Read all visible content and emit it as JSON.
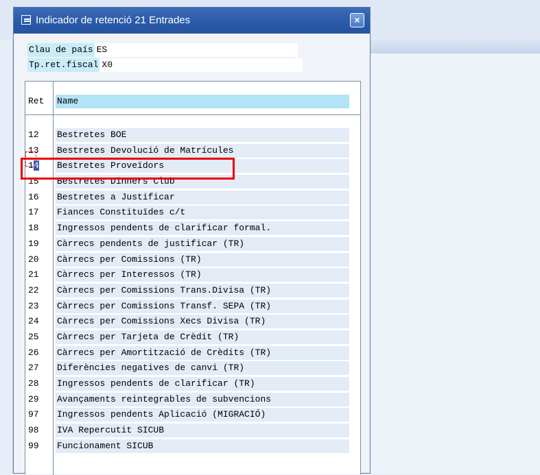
{
  "popup": {
    "title": "Indicador de retenció 21 Entrades",
    "close_label": "×"
  },
  "criteria": [
    {
      "label": "Clau de país",
      "value": "ES"
    },
    {
      "label": "Tp.ret.fiscal",
      "value": "X0"
    }
  ],
  "table": {
    "columns": [
      "Ret",
      "Name"
    ],
    "selected_code": "14",
    "rows": [
      {
        "code": "12",
        "name": "Bestretes BOE"
      },
      {
        "code": "13",
        "name": "Bestretes Devolució de Matrícules"
      },
      {
        "code": "14",
        "name": "Bestretes Proveïdors"
      },
      {
        "code": "15",
        "name": "Bestretes Dinners Club"
      },
      {
        "code": "16",
        "name": "Bestretes a Justificar"
      },
      {
        "code": "17",
        "name": "Fiances Constituïdes c/t"
      },
      {
        "code": "18",
        "name": "Ingressos pendents de clarificar formal."
      },
      {
        "code": "19",
        "name": "Càrrecs pendents de justificar (TR)"
      },
      {
        "code": "20",
        "name": "Càrrecs per Comissions (TR)"
      },
      {
        "code": "21",
        "name": "Càrrecs per Interessos (TR)"
      },
      {
        "code": "22",
        "name": "Càrrecs per Comissions Trans.Divisa (TR)"
      },
      {
        "code": "23",
        "name": "Càrrecs per Comissions Transf. SEPA (TR)"
      },
      {
        "code": "24",
        "name": "Càrrecs per Comissions Xecs Divisa (TR)"
      },
      {
        "code": "25",
        "name": "Càrrecs per Tarjeta de Crèdit (TR)"
      },
      {
        "code": "26",
        "name": "Càrrecs per Amortització de Crèdits (TR)"
      },
      {
        "code": "27",
        "name": "Diferències negatives de canvi (TR)"
      },
      {
        "code": "28",
        "name": "Ingressos pendents de clarificar (TR)"
      },
      {
        "code": "29",
        "name": "Avançaments reintegrables de subvencions"
      },
      {
        "code": "97",
        "name": "Ingressos pendents Aplicació (MIGRACIÓ)"
      },
      {
        "code": "98",
        "name": "IVA Repercutit SICUB"
      },
      {
        "code": "99",
        "name": "Funcionament SICUB"
      }
    ]
  }
}
